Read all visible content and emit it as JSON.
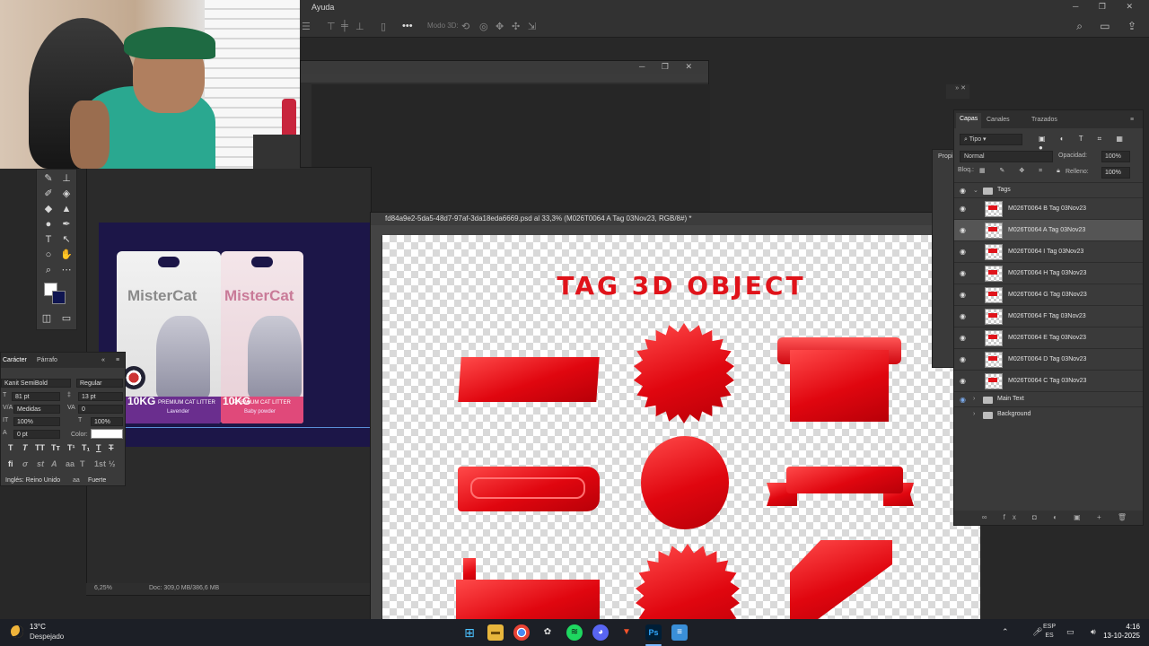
{
  "app": {
    "menu_visible": "Ayuda",
    "options_bar": {
      "mode_3d_label": "Modo 3D:"
    },
    "accent_color": "#e0131a"
  },
  "webcam": {
    "description_icon": "webcam-feed"
  },
  "tools": {
    "fg_color": "#ffffff",
    "bg_color": "#0f1550"
  },
  "product_window": {
    "zoom": "6,25%",
    "doc_info": "Doc: 309,0 MB/386,6 MB",
    "bags": [
      {
        "brand": "MisterCat",
        "weight": "10KG",
        "line": "PREMIUM CAT LITTER",
        "variant": "Lavender"
      },
      {
        "brand": "MisterCat",
        "weight": "10KG",
        "line": "PREMIUM CAT LITTER",
        "variant": "Baby powder"
      }
    ]
  },
  "character_panel": {
    "tabs": [
      "Carácter",
      "Párrafo"
    ],
    "font_family": "Kanit SemiBold",
    "font_style": "Regular",
    "font_size": "81 pt",
    "leading": "13 pt",
    "kerning": "Medidas",
    "tracking": "0",
    "vertical_scale": "100%",
    "horizontal_scale": "100%",
    "baseline": "0 pt",
    "color_label": "Color:",
    "language": "Inglés: Reino Unido",
    "antialias": "Fuerte",
    "aa_label": "aa"
  },
  "document": {
    "tab_title": "fd84a9e2-5da5-48d7-97af-3da18eda6669.psd al 33,3% (M026T0064 A Tag  03Nov23, RGB/8#) *",
    "canvas_title": "TAG 3D OBJECT"
  },
  "layers_panel": {
    "tabs": [
      "Capas",
      "Canales",
      "Trazados"
    ],
    "filter_label": "Tipo",
    "blend_mode": "Normal",
    "opacity_label": "Opacidad:",
    "opacity": "100%",
    "lock_label": "Bloq.:",
    "fill_label": "Relleno:",
    "fill": "100%",
    "props_label": "Propi",
    "layers": [
      {
        "name": "Tags",
        "type": "group",
        "visible": true,
        "expanded": true
      },
      {
        "name": "M026T0064 B Tag  03Nov23",
        "type": "layer",
        "visible": true,
        "selected": false
      },
      {
        "name": "M026T0064 A Tag  03Nov23",
        "type": "layer",
        "visible": true,
        "selected": true
      },
      {
        "name": "M026T0064 I Tag  03Nov23",
        "type": "layer",
        "visible": true,
        "selected": false
      },
      {
        "name": "M026T0064 H Tag  03Nov23",
        "type": "layer",
        "visible": true,
        "selected": false
      },
      {
        "name": "M026T0064 G Tag  03Nov23",
        "type": "layer",
        "visible": true,
        "selected": false
      },
      {
        "name": "M026T0064 F Tag  03Nov23",
        "type": "layer",
        "visible": true,
        "selected": false
      },
      {
        "name": "M026T0064 E Tag  03Nov23",
        "type": "layer",
        "visible": true,
        "selected": false
      },
      {
        "name": "M026T0064 D Tag  03Nov23",
        "type": "layer",
        "visible": true,
        "selected": false
      },
      {
        "name": "M026T0064 C Tag  03Nov23",
        "type": "layer",
        "visible": true,
        "selected": false
      },
      {
        "name": "Main Text",
        "type": "group",
        "visible": true,
        "expanded": false
      },
      {
        "name": "Background",
        "type": "group",
        "visible": false,
        "expanded": false
      }
    ]
  },
  "taskbar": {
    "temperature": "13°C",
    "weather": "Despejado",
    "lang_top": "ESP",
    "lang_bottom": "ES",
    "time": "4:16",
    "date": "13-10-2025",
    "apps": [
      "windows-start",
      "file-explorer",
      "chrome",
      "chatgpt",
      "spotify",
      "discord",
      "brave",
      "photoshop",
      "notepad"
    ]
  }
}
